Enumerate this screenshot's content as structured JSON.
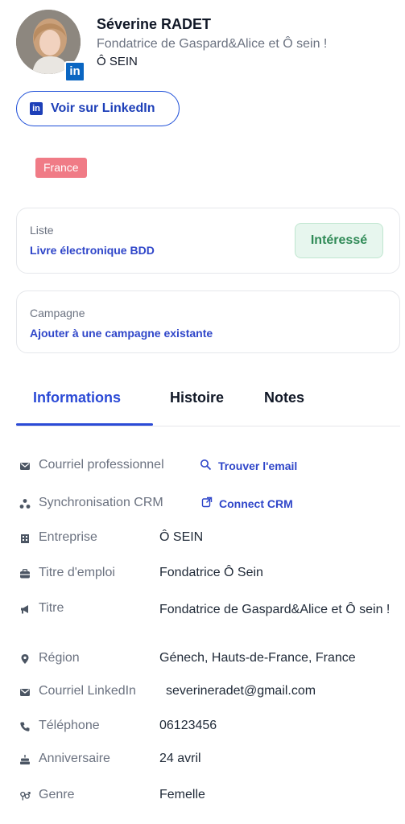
{
  "profile": {
    "name": "Séverine RADET",
    "headline": "Fondatrice de Gaspard&Alice et Ô sein !",
    "company": "Ô SEIN",
    "linkedin_button": "Voir sur LinkedIn",
    "country_tag": "France"
  },
  "list_card": {
    "label": "Liste",
    "value": "Livre électronique BDD",
    "status": "Intéressé",
    "status_color": "#2f8a56"
  },
  "campaign_card": {
    "label": "Campagne",
    "action": "Ajouter à une campagne existante"
  },
  "tabs": [
    {
      "label": "Informations",
      "active": true
    },
    {
      "label": "Histoire",
      "active": false
    },
    {
      "label": "Notes",
      "active": false
    }
  ],
  "info": {
    "pro_email": {
      "key": "Courriel professionnel",
      "action": "Trouver l'email",
      "icon": "envelope-icon",
      "action_icon": "search-icon"
    },
    "crm": {
      "key": "Synchronisation CRM",
      "action": "Connect CRM",
      "icon": "sync-icon",
      "action_icon": "external-link-icon"
    },
    "company": {
      "key": "Entreprise",
      "value": "Ô SEIN",
      "icon": "building-icon"
    },
    "job_title": {
      "key": "Titre d'emploi",
      "value": "Fondatrice Ô Sein",
      "icon": "briefcase-icon"
    },
    "title": {
      "key": "Titre",
      "value": "Fondatrice de Gaspard&Alice et Ô sein !",
      "icon": "megaphone-icon"
    },
    "region": {
      "key": "Région",
      "value": "Génech, Hauts-de-France, France",
      "icon": "location-icon"
    },
    "linkedin_email": {
      "key": "Courriel LinkedIn",
      "value": "severineradet@gmail.com",
      "icon": "envelope-icon"
    },
    "phone": {
      "key": "Téléphone",
      "value": "06123456",
      "icon": "phone-icon"
    },
    "birthday": {
      "key": "Anniversaire",
      "value": "24 avril",
      "icon": "cake-icon"
    },
    "gender": {
      "key": "Genre",
      "value": "Femelle",
      "icon": "gender-icon"
    }
  },
  "colors": {
    "accent": "#2b4ad6",
    "linkedin": "#0a66c2",
    "tag": "#f07b86"
  }
}
